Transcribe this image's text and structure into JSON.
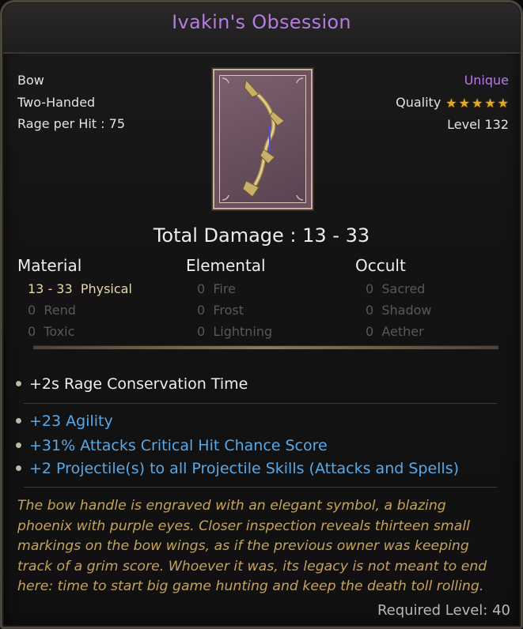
{
  "item": {
    "name": "Ivakin's Obsession",
    "type": "Bow",
    "handedness": "Two-Handed",
    "rage_per_hit": "Rage per Hit : 75",
    "rarity": "Unique",
    "quality_label": "Quality",
    "quality_stars": 5,
    "level": "Level 132",
    "rarity_color": "#b57be0"
  },
  "damage": {
    "total": "Total Damage : 13 - 33",
    "columns": [
      {
        "header": "Material",
        "rows": [
          {
            "text": "13 - 33  Physical",
            "active": true
          },
          {
            "text": "0  Rend",
            "active": false
          },
          {
            "text": "0  Toxic",
            "active": false
          }
        ]
      },
      {
        "header": "Elemental",
        "rows": [
          {
            "text": "0  Fire",
            "active": false
          },
          {
            "text": "0  Frost",
            "active": false
          },
          {
            "text": "0  Lightning",
            "active": false
          }
        ]
      },
      {
        "header": "Occult",
        "rows": [
          {
            "text": "0  Sacred",
            "active": false
          },
          {
            "text": "0  Shadow",
            "active": false
          },
          {
            "text": "0  Aether",
            "active": false
          }
        ]
      }
    ]
  },
  "modifiers": {
    "base": [
      "+2s Rage Conservation Time"
    ],
    "magic": [
      "+23 Agility",
      "+31% Attacks Critical Hit Chance Score",
      "+2 Projectile(s) to all Projectile Skills (Attacks and Spells)"
    ],
    "magic_color": "#57a9e8"
  },
  "lore": [
    "The bow handle is engraved with an elegant symbol, a blazing",
    "phoenix with purple eyes. Closer inspection reveals thirteen small",
    "markings on the bow wings, as if the previous owner was keeping",
    "track of a grim score. Whoever it was, its legacy is not meant to end",
    "here: time to start big game hunting and keep the death toll rolling."
  ],
  "required_level": "Required Level: 40",
  "icons": {
    "quality_star": "star-icon",
    "item_image": "bow-icon",
    "bullet": "bullet-icon"
  }
}
